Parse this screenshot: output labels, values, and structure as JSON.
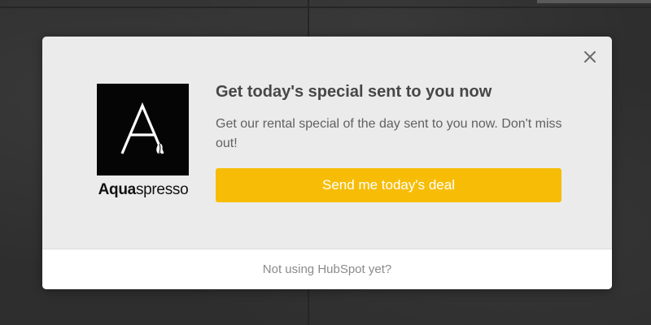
{
  "popup": {
    "title": "Get today's special sent to you now",
    "subtitle": "Get our rental special of the day sent to you now. Don't miss out!",
    "cta_label": "Send me today's deal",
    "close_icon": "close-icon",
    "footer_link": "Not using HubSpot yet?"
  },
  "brand": {
    "name_bold": "Aqua",
    "name_light": "spresso",
    "logo_letter": "A"
  },
  "colors": {
    "accent": "#f7bd06",
    "modal_bg": "#ebebeb",
    "footer_bg": "#ffffff",
    "title": "#474747",
    "backdrop": "#2e2e2e"
  }
}
